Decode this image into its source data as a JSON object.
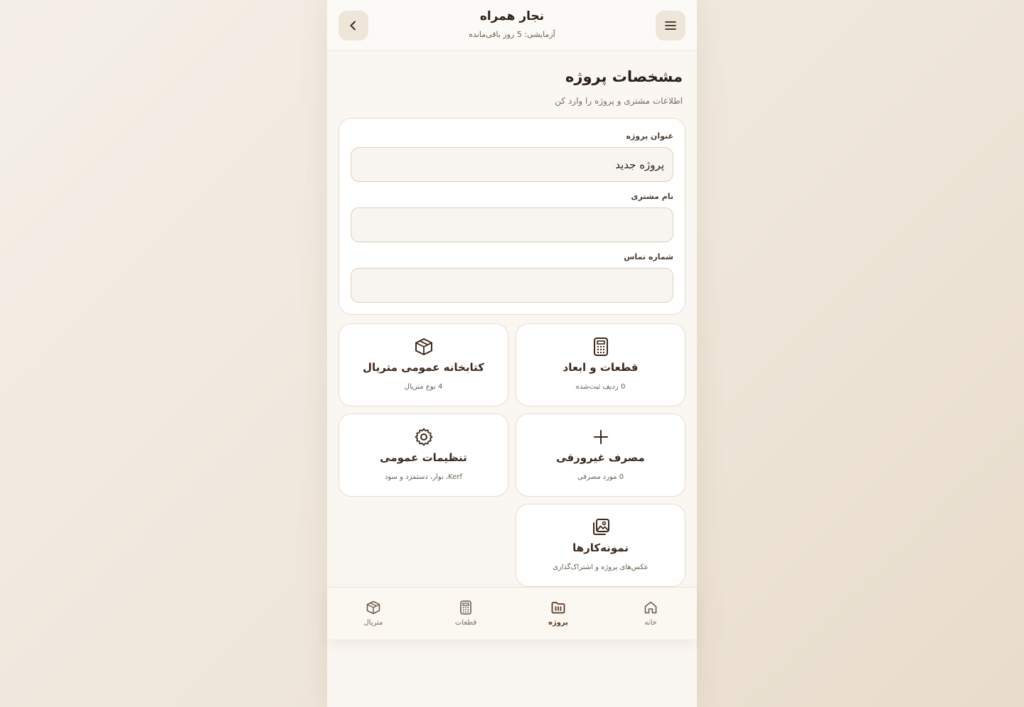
{
  "header": {
    "title": "نجار همراه",
    "subtitle": "آزمایشی: 5 روز باقی‌مانده",
    "menu_icon": "menu-icon",
    "back_icon": "chevron-left-icon"
  },
  "page": {
    "title": "مشخصات پروژه",
    "subtitle": "اطلاعات مشتری و پروژه را وارد کن"
  },
  "form": {
    "project_title_label": "عنوان پروژه",
    "project_title_value": "پروژه جدید",
    "client_name_label": "نام مشتری",
    "client_name_value": "",
    "phone_label": "شماره تماس",
    "phone_value": ""
  },
  "tiles": [
    {
      "title": "قطعات و ابعاد",
      "desc": "0 ردیف ثبت‌شده",
      "icon": "calculator-icon"
    },
    {
      "title": "کتابخانه عمومی متریال",
      "desc": "4 نوع متریال",
      "icon": "box-icon"
    },
    {
      "title": "مصرف غیرورقی",
      "desc": "0 مورد مصرفی",
      "icon": "plus-icon"
    },
    {
      "title": "تنظیمات عمومی",
      "desc": "Kerf، نوار، دستمزد و سود",
      "icon": "gear-icon"
    },
    {
      "title": "نمونه‌کارها",
      "desc": "عکس‌های پروژه و اشتراک‌گذاری",
      "icon": "gallery-icon"
    }
  ],
  "bottom_nav": [
    {
      "label": "خانه",
      "icon": "home-icon",
      "active": false
    },
    {
      "label": "پروژه",
      "icon": "project-icon",
      "active": true
    },
    {
      "label": "قطعات",
      "icon": "calculator-icon",
      "active": false
    },
    {
      "label": "متریال",
      "icon": "box-icon",
      "active": false
    }
  ],
  "colors": {
    "accent": "#5a3a22",
    "background": "#faf7f2",
    "card": "#ffffff",
    "border": "#e6dccf"
  }
}
